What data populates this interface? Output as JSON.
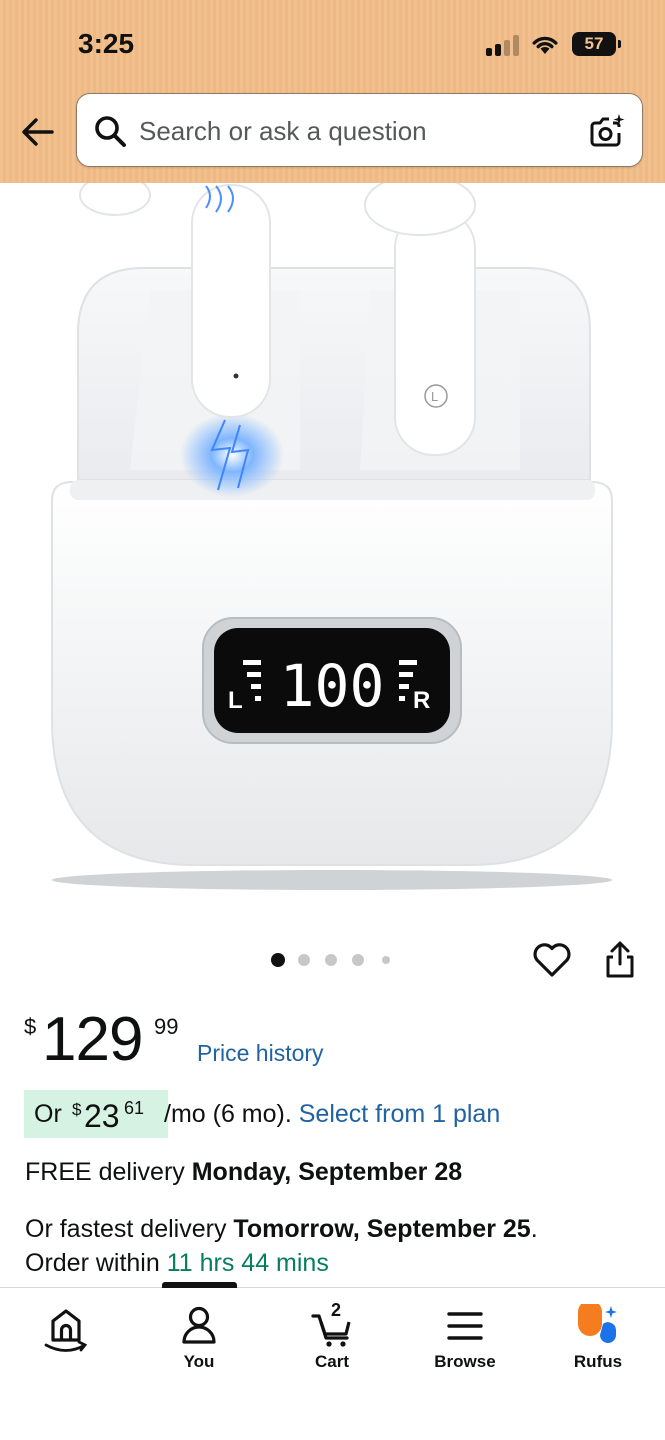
{
  "status_bar": {
    "time": "3:25",
    "battery": "57",
    "signal_icon": "cellular-signal-icon",
    "wifi_icon": "wifi-icon"
  },
  "header": {
    "back_icon": "back-arrow-icon",
    "search": {
      "placeholder": "Search or ask a question",
      "value": "",
      "search_icon": "search-icon",
      "camera_icon": "camera-search-icon"
    }
  },
  "product_image": {
    "display_text": "100",
    "left_mark": "L",
    "right_mark": "R"
  },
  "carousel": {
    "total_dots": 5,
    "active_index": 0
  },
  "actions": {
    "wishlist_icon": "heart-icon",
    "share_icon": "share-icon"
  },
  "price": {
    "symbol": "$",
    "whole": "129",
    "fraction": "99",
    "history_link": "Price history"
  },
  "monthly": {
    "prefix": "Or",
    "symbol": "$",
    "whole": "23",
    "fraction": "61",
    "suffix": "/mo (6 mo).",
    "plan_link": "Select from 1 plan"
  },
  "delivery": {
    "prefix": "FREE delivery",
    "date": "Monday, September 28"
  },
  "fastest": {
    "prefix": "Or fastest delivery",
    "date": "Tomorrow, September 25",
    "period": ".",
    "order_within": "Order within",
    "countdown": "11 hrs 44 mins"
  },
  "bottom_nav": {
    "items": [
      {
        "label": "",
        "icon": "home-icon"
      },
      {
        "label": "You",
        "icon": "person-icon"
      },
      {
        "label": "Cart",
        "icon": "cart-icon",
        "count": "2"
      },
      {
        "label": "Browse",
        "icon": "menu-icon"
      },
      {
        "label": "Rufus",
        "icon": "rufus-icon"
      }
    ]
  },
  "colors": {
    "header_bg": "#f2c08e",
    "link": "#2162a1",
    "deal_bg": "#d5f2e3",
    "countdown": "#067d62",
    "rufus_orange": "#f57c1f",
    "rufus_blue": "#1a73e8"
  }
}
